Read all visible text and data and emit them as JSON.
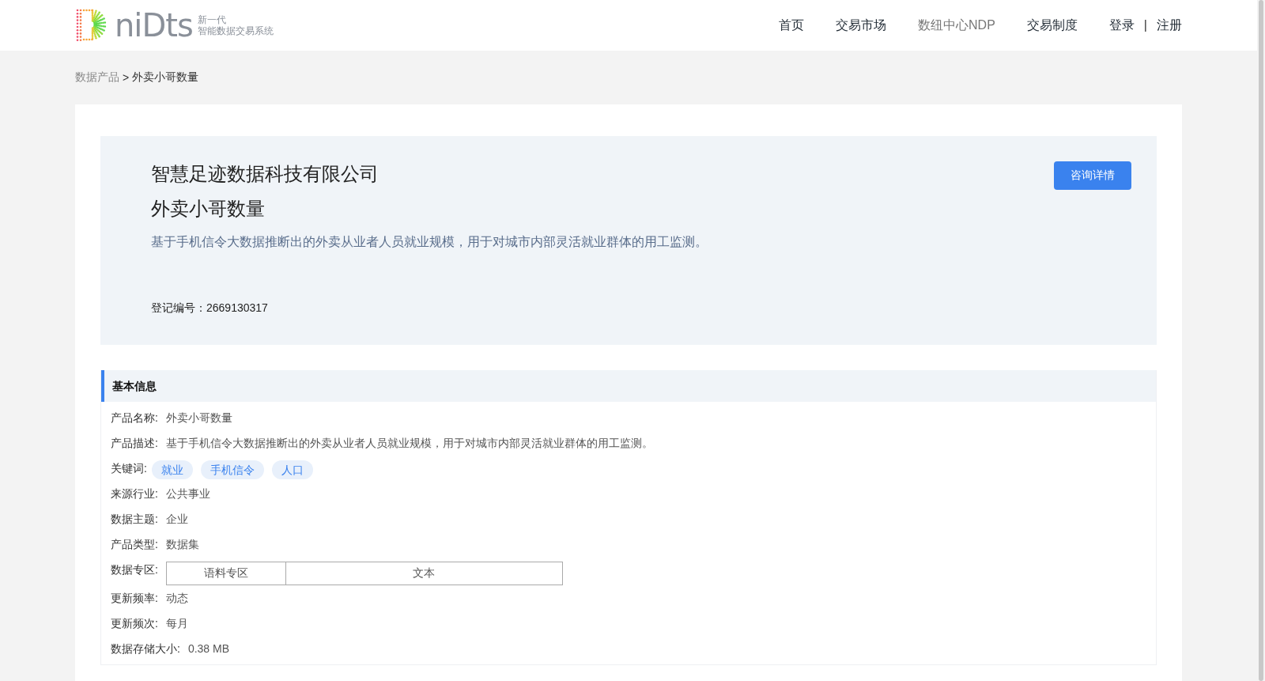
{
  "header": {
    "logo": {
      "wordmark": "niDts",
      "tagline_1": "新一代",
      "tagline_2": "智能数据交易系统"
    },
    "nav": [
      {
        "label": "首页",
        "selected": false
      },
      {
        "label": "交易市场",
        "selected": false
      },
      {
        "label": "数纽中心NDP",
        "selected": true
      },
      {
        "label": "交易制度",
        "selected": false
      }
    ],
    "auth": {
      "login": "登录",
      "separator": "|",
      "register": "注册"
    }
  },
  "breadcrumb": {
    "parent": "数据产品",
    "separator": ">",
    "current": "外卖小哥数量"
  },
  "hero": {
    "company": "智慧足迹数据科技有限公司",
    "product": "外卖小哥数量",
    "description": "基于手机信令大数据推断出的外卖从业者人员就业规模，用于对城市内部灵活就业群体的用工监测。",
    "registration": "登记编号：2669130317",
    "button": "咨询详情"
  },
  "basic_info": {
    "title": "基本信息",
    "rows": [
      {
        "kind": "text",
        "label": "产品名称:",
        "value": "外卖小哥数量"
      },
      {
        "kind": "text",
        "label": "产品描述:",
        "value": "基于手机信令大数据推断出的外卖从业者人员就业规模，用于对城市内部灵活就业群体的用工监测。"
      },
      {
        "kind": "tags",
        "label": "关键词:",
        "tags": [
          "就业",
          "手机信令",
          "人口"
        ]
      },
      {
        "kind": "text",
        "label": "来源行业:",
        "value": "公共事业"
      },
      {
        "kind": "text",
        "label": "数据主题:",
        "value": "企业"
      },
      {
        "kind": "text",
        "label": "产品类型:",
        "value": "数据集"
      },
      {
        "kind": "table",
        "label": "数据专区:",
        "cells": [
          "语料专区",
          "文本"
        ]
      },
      {
        "kind": "text",
        "label": "更新频率:",
        "value": "动态"
      },
      {
        "kind": "text",
        "label": "更新频次:",
        "value": "每月"
      },
      {
        "kind": "text",
        "label": "数据存储大小:",
        "value": "0.38 MB"
      }
    ]
  }
}
